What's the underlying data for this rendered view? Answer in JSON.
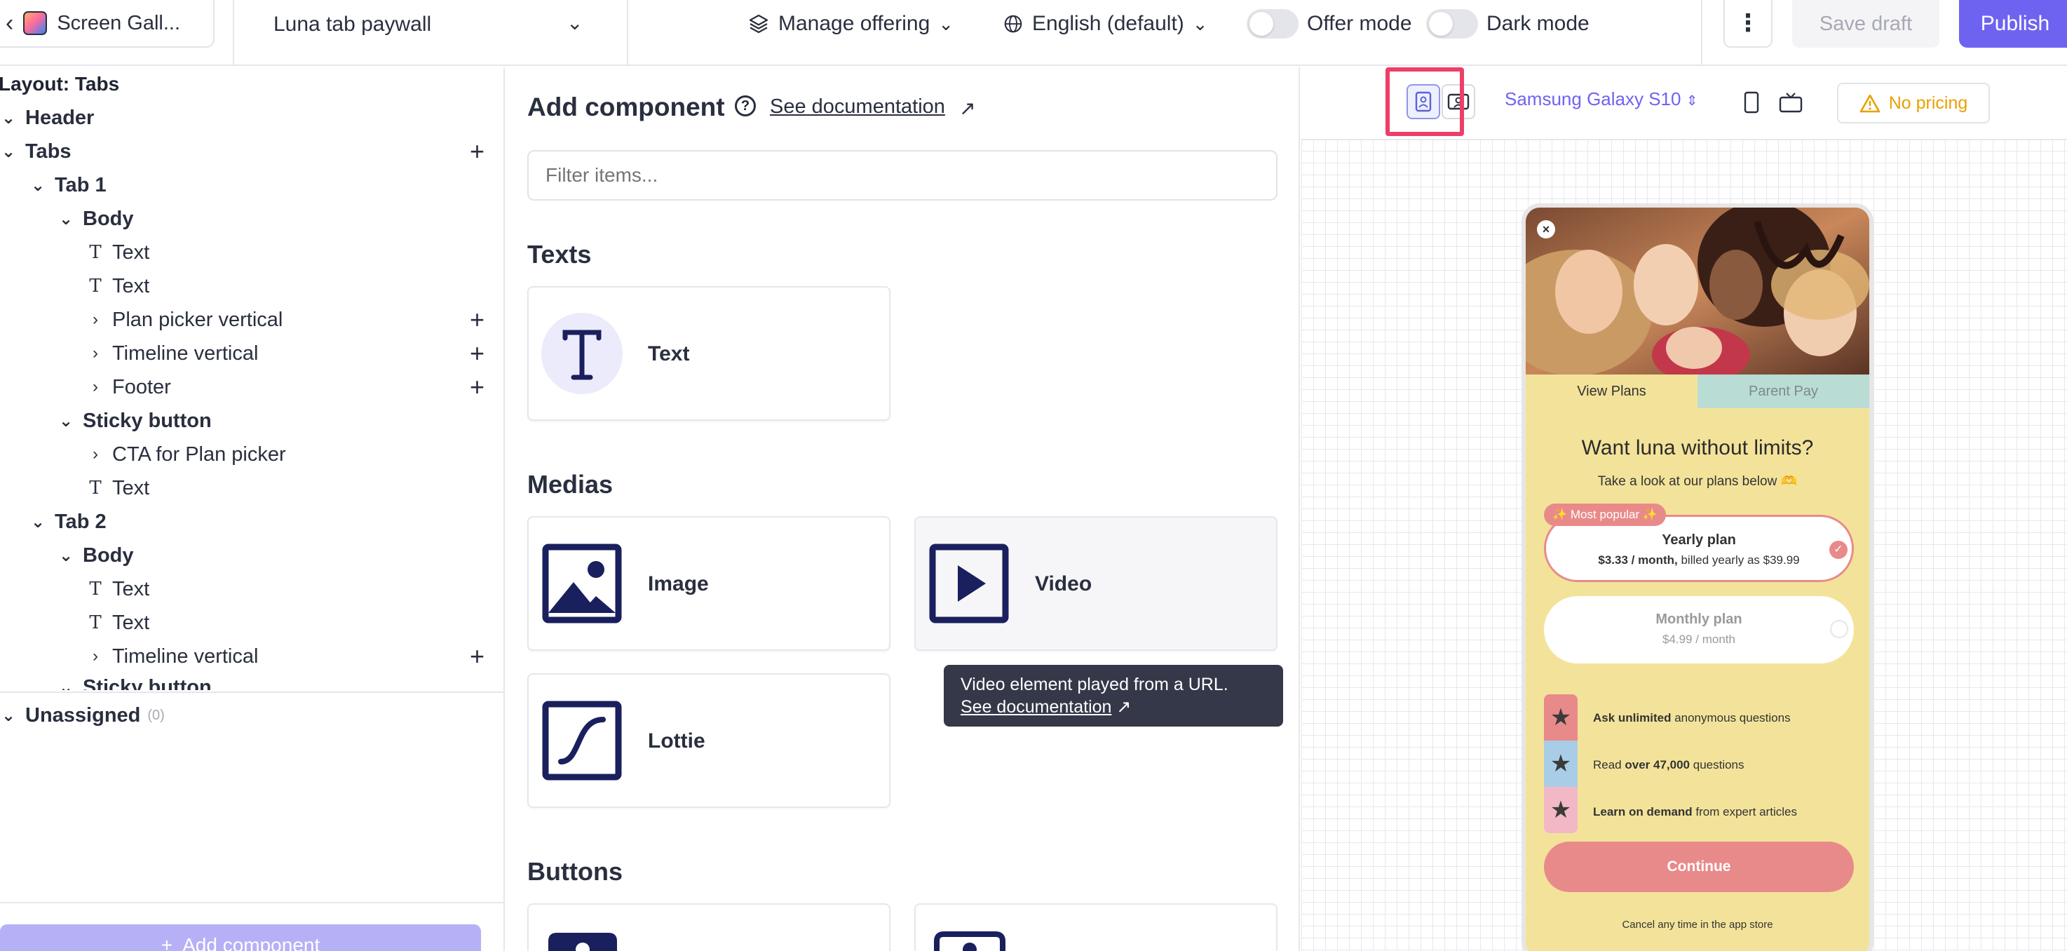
{
  "topbar": {
    "project_name": "Screen Gall...",
    "paywall_name": "Luna tab paywall",
    "manage_offering": "Manage offering",
    "language": "English (default)",
    "offer_mode": "Offer mode",
    "dark_mode": "Dark mode",
    "save_draft": "Save draft",
    "publish": "Publish"
  },
  "tree": {
    "layout_title": "Layout: Tabs",
    "header": "Header",
    "tabs": "Tabs",
    "tab1": "Tab 1",
    "body": "Body",
    "text": "Text",
    "plan_picker": "Plan picker vertical",
    "timeline": "Timeline vertical",
    "footer": "Footer",
    "sticky_button": "Sticky button",
    "cta": "CTA for Plan picker",
    "tab2": "Tab 2",
    "unassigned": "Unassigned",
    "unassigned_count": "(0)",
    "add_component": "Add component"
  },
  "components": {
    "title": "Add component",
    "doc_link": "See documentation",
    "filter_placeholder": "Filter items...",
    "texts_heading": "Texts",
    "text_label": "Text",
    "medias_heading": "Medias",
    "image_label": "Image",
    "video_label": "Video",
    "lottie_label": "Lottie",
    "buttons_heading": "Buttons",
    "tooltip_text": "Video element played from a URL.",
    "tooltip_link": "See documentation"
  },
  "preview": {
    "device": "Samsung Galaxy S10",
    "no_pricing": "No pricing",
    "tab_view_plans": "View Plans",
    "tab_parent_pay": "Parent Pay",
    "headline": "Want luna without limits?",
    "subheadline": "Take a look at our plans below 🫶",
    "badge": "✨ Most popular ✨",
    "yearly_name": "Yearly plan",
    "yearly_price_bold": "$3.33 / month,",
    "yearly_price_rest": " billed yearly as $39.99",
    "monthly_name": "Monthly plan",
    "monthly_price": "$4.99 / month",
    "feat1_bold": "Ask unlimited",
    "feat1_rest": " anonymous questions",
    "feat2_pre": "Read ",
    "feat2_bold": "over 47,000",
    "feat2_rest": " questions",
    "feat3_bold": "Learn on demand",
    "feat3_rest": " from expert articles",
    "continue": "Continue",
    "cancel_note": "Cancel any time in the app store"
  },
  "colors": {
    "accent": "#6e63f1",
    "highlight": "#ec3f68",
    "paywall_bg": "#f3e39a",
    "plan_accent": "#e98a8a"
  }
}
